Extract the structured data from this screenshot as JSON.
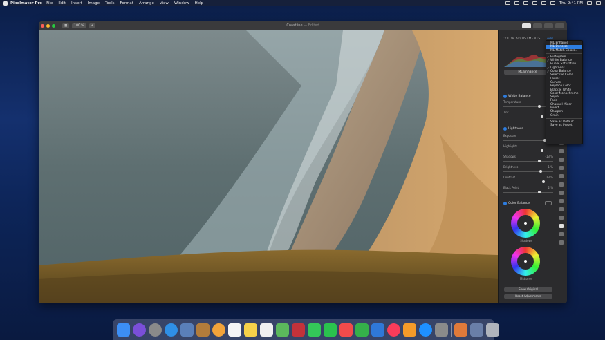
{
  "menubar": {
    "app_name": "Pixelmator Pro",
    "items": [
      "File",
      "Edit",
      "Insert",
      "Image",
      "Tools",
      "Format",
      "Arrange",
      "View",
      "Window",
      "Help"
    ],
    "clock": "Thu 9:41 PM"
  },
  "window": {
    "zoom": "100 %",
    "doc_title": "Coastline",
    "doc_status": "— Edited",
    "traffic_colors": [
      "#fe5f57",
      "#febc2e",
      "#28c840"
    ]
  },
  "sidebar": {
    "heading": "COLOR ADJUSTMENTS",
    "add_label": "Add",
    "ml_enhance": "ML Enhance",
    "white_balance": {
      "title": "White Balance",
      "rows": [
        {
          "label": "Temperature",
          "value": "",
          "pos": 0.7
        },
        {
          "label": "Tint",
          "value": "",
          "pos": 0.75
        }
      ]
    },
    "lightness": {
      "title": "Lightness",
      "rows": [
        {
          "label": "Exposure",
          "value": "",
          "pos": 0.8
        },
        {
          "label": "Highlights",
          "value": "",
          "pos": 0.75
        },
        {
          "label": "Shadows",
          "value": "-13 %",
          "pos": 0.7
        },
        {
          "label": "Brightness",
          "value": "1 %",
          "pos": 0.72
        },
        {
          "label": "Contrast",
          "value": "23 %",
          "pos": 0.78
        },
        {
          "label": "Black Point",
          "value": "2 %",
          "pos": 0.7
        }
      ]
    },
    "color_balance": {
      "title": "Color Balance",
      "wheels": [
        "Shadows",
        "Midtones"
      ]
    },
    "show_original": "Show Original",
    "reset": "Reset Adjustments"
  },
  "add_menu": [
    {
      "label": "ML Enhance",
      "checked": false,
      "selected": false
    },
    {
      "label": "ML Denoise",
      "checked": false,
      "selected": true
    },
    {
      "label": "ML Match Colors...",
      "checked": false,
      "selected": false
    },
    {
      "sep": true
    },
    {
      "label": "Histogram",
      "checked": true
    },
    {
      "label": "White Balance",
      "checked": true
    },
    {
      "label": "Hue & Saturation",
      "checked": false
    },
    {
      "label": "Lightness",
      "checked": true
    },
    {
      "label": "Color Balance",
      "checked": true
    },
    {
      "label": "Selective Color",
      "checked": false
    },
    {
      "label": "Levels",
      "checked": false
    },
    {
      "label": "Curves",
      "checked": false
    },
    {
      "label": "Replace Color",
      "checked": false
    },
    {
      "label": "Black & White",
      "checked": false
    },
    {
      "label": "Color Monochrome",
      "checked": false
    },
    {
      "label": "Sepia",
      "checked": false
    },
    {
      "label": "Fade",
      "checked": false
    },
    {
      "label": "Channel Mixer",
      "checked": false
    },
    {
      "label": "Invert",
      "checked": false
    },
    {
      "label": "Sharpen",
      "checked": false
    },
    {
      "label": "Grain",
      "checked": false
    },
    {
      "sep": true
    },
    {
      "label": "Save as Default",
      "checked": false
    },
    {
      "label": "Save as Preset",
      "checked": false
    }
  ],
  "dock": [
    {
      "name": "finder-icon",
      "color": "#3c8ef5"
    },
    {
      "name": "siri-icon",
      "color": "#7a4fd8"
    },
    {
      "name": "launchpad-icon",
      "color": "#8a8a8a"
    },
    {
      "name": "safari-icon",
      "color": "#2f8fe6"
    },
    {
      "name": "preview-icon",
      "color": "#5a7fb8"
    },
    {
      "name": "notefile-icon",
      "color": "#b27c3b"
    },
    {
      "name": "photos-icon",
      "color": "#f2a33a"
    },
    {
      "name": "calendar-icon",
      "color": "#f5f5f5"
    },
    {
      "name": "notes-icon",
      "color": "#f7d24a"
    },
    {
      "name": "reminders-icon",
      "color": "#f0f0f0"
    },
    {
      "name": "maps-icon",
      "color": "#5cb85c"
    },
    {
      "name": "photo-booth-icon",
      "color": "#c4323a"
    },
    {
      "name": "messages-icon",
      "color": "#34c759"
    },
    {
      "name": "facetime-icon",
      "color": "#2ac34e"
    },
    {
      "name": "news-icon",
      "color": "#f24b4b"
    },
    {
      "name": "numbers-icon",
      "color": "#35b04a"
    },
    {
      "name": "keynote-icon",
      "color": "#2f78d8"
    },
    {
      "name": "music-icon",
      "color": "#fa3c5a"
    },
    {
      "name": "books-icon",
      "color": "#f49b2a"
    },
    {
      "name": "app-store-icon",
      "color": "#1e90ff"
    },
    {
      "name": "system-preferences-icon",
      "color": "#8b8b8b"
    },
    {
      "name": "pixelmator-icon",
      "color": "#e07a3a"
    },
    {
      "name": "downloads-icon",
      "color": "#6a7fa8"
    },
    {
      "name": "trash-icon",
      "color": "#b0b4bc"
    }
  ]
}
